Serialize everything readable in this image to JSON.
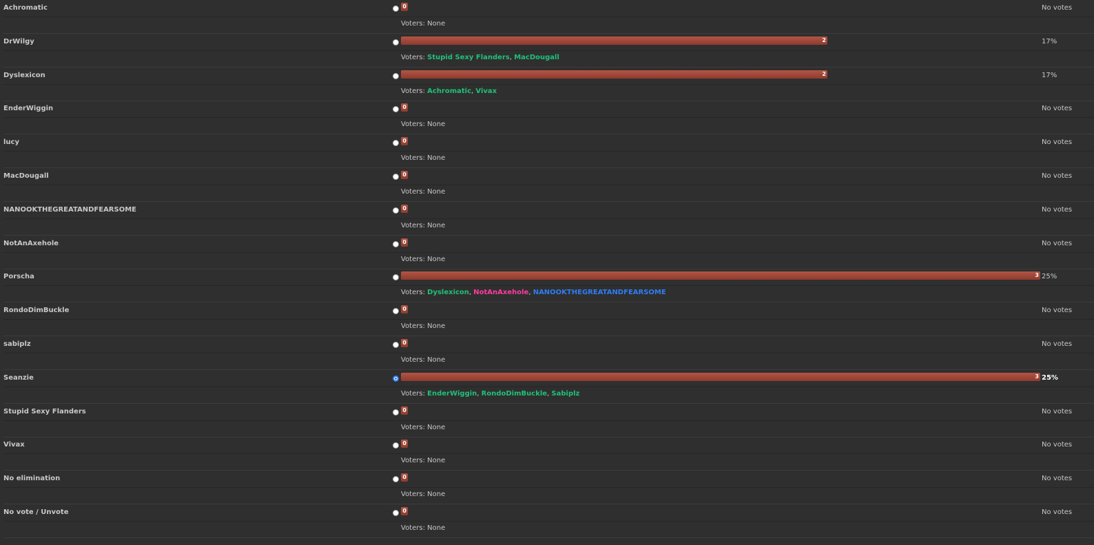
{
  "voters_label": "Voters:",
  "colors": {
    "bar": "#a34a3b",
    "voter_green": "#20c07a",
    "voter_pink": "#ff3c9e",
    "voter_blue": "#2f7cf6",
    "radio_selected": "#2f7cf6"
  },
  "options": [
    {
      "name": "Achromatic",
      "count": "0",
      "fraction": 0,
      "percent": "No votes",
      "selected": false,
      "none_text": "None",
      "voters": []
    },
    {
      "name": "DrWilgy",
      "count": "2",
      "fraction": 0.6667,
      "percent": "17%",
      "selected": false,
      "none_text": "",
      "voters": [
        {
          "name": "Stupid Sexy Flanders",
          "color": "#20c07a"
        },
        {
          "name": "MacDougall",
          "color": "#20c07a"
        }
      ]
    },
    {
      "name": "Dyslexicon",
      "count": "2",
      "fraction": 0.6667,
      "percent": "17%",
      "selected": false,
      "none_text": "",
      "voters": [
        {
          "name": "Achromatic",
          "color": "#20c07a"
        },
        {
          "name": "Vivax",
          "color": "#20c07a"
        }
      ]
    },
    {
      "name": "EnderWiggin",
      "count": "0",
      "fraction": 0,
      "percent": "No votes",
      "selected": false,
      "none_text": "None",
      "voters": []
    },
    {
      "name": "lucy",
      "count": "0",
      "fraction": 0,
      "percent": "No votes",
      "selected": false,
      "none_text": "None",
      "voters": []
    },
    {
      "name": "MacDougall",
      "count": "0",
      "fraction": 0,
      "percent": "No votes",
      "selected": false,
      "none_text": "None",
      "voters": []
    },
    {
      "name": "NANOOKTHEGREATANDFEARSOME",
      "count": "0",
      "fraction": 0,
      "percent": "No votes",
      "selected": false,
      "none_text": "None",
      "voters": []
    },
    {
      "name": "NotAnAxehole",
      "count": "0",
      "fraction": 0,
      "percent": "No votes",
      "selected": false,
      "none_text": "None",
      "voters": []
    },
    {
      "name": "Porscha",
      "count": "3",
      "fraction": 1,
      "percent": "25%",
      "selected": false,
      "none_text": "",
      "voters": [
        {
          "name": "Dyslexicon",
          "color": "#20c07a"
        },
        {
          "name": "NotAnAxehole",
          "color": "#ff3c9e"
        },
        {
          "name": "NANOOKTHEGREATANDFEARSOME",
          "color": "#2f7cf6"
        }
      ]
    },
    {
      "name": "RondoDimBuckle",
      "count": "0",
      "fraction": 0,
      "percent": "No votes",
      "selected": false,
      "none_text": "None",
      "voters": []
    },
    {
      "name": "sabiplz",
      "count": "0",
      "fraction": 0,
      "percent": "No votes",
      "selected": false,
      "none_text": "None",
      "voters": []
    },
    {
      "name": "Seanzie",
      "count": "3",
      "fraction": 1,
      "percent": "25%",
      "selected": true,
      "none_text": "",
      "voters": [
        {
          "name": "EnderWiggin",
          "color": "#20c07a"
        },
        {
          "name": "RondoDimBuckle",
          "color": "#20c07a"
        },
        {
          "name": "Sabiplz",
          "color": "#20c07a"
        }
      ]
    },
    {
      "name": "Stupid Sexy Flanders",
      "count": "0",
      "fraction": 0,
      "percent": "No votes",
      "selected": false,
      "none_text": "None",
      "voters": []
    },
    {
      "name": "Vivax",
      "count": "0",
      "fraction": 0,
      "percent": "No votes",
      "selected": false,
      "none_text": "None",
      "voters": []
    },
    {
      "name": "No elimination",
      "count": "0",
      "fraction": 0,
      "percent": "No votes",
      "selected": false,
      "none_text": "None",
      "voters": []
    },
    {
      "name": "No vote / Unvote",
      "count": "0",
      "fraction": 0,
      "percent": "No votes",
      "selected": false,
      "none_text": "None",
      "voters": []
    }
  ]
}
